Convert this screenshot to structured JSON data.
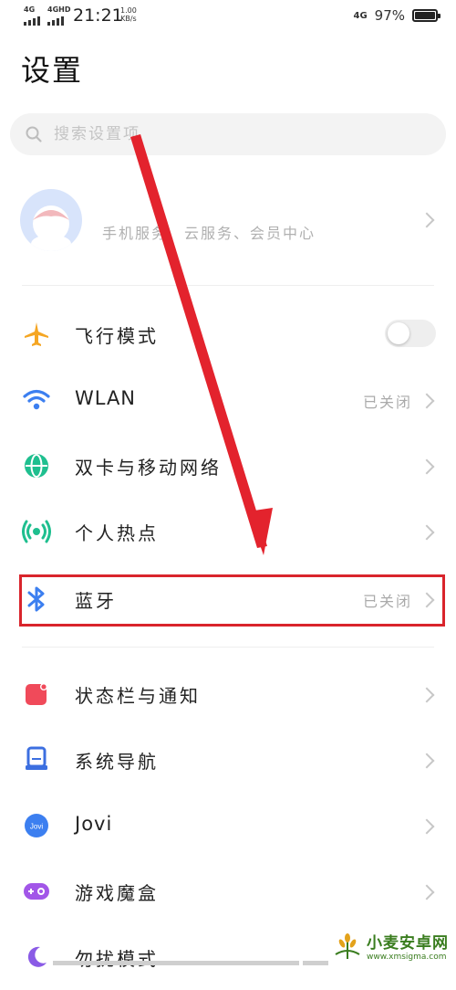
{
  "status_bar": {
    "sim1_label": "4G",
    "sim2_label": "4GHD",
    "time": "21:21",
    "speed_value": "1.00",
    "speed_unit": "KB/s",
    "network_label": "4G",
    "battery": "97%",
    "battery_level": 0.97
  },
  "title": "设置",
  "search": {
    "placeholder": "搜索设置项"
  },
  "account": {
    "text": "手机服务、云服务、会员中心"
  },
  "items": [
    {
      "label": "飞行模式",
      "icon": "airplane-icon",
      "color": "#f5a623",
      "toggle": false
    },
    {
      "label": "WLAN",
      "icon": "wifi-icon",
      "color": "#3c7ff0",
      "value": "已关闭"
    },
    {
      "label": "双卡与移动网络",
      "icon": "globe-icon",
      "color": "#1fbf8f"
    },
    {
      "label": "个人热点",
      "icon": "hotspot-icon",
      "color": "#1fbf8f"
    },
    {
      "label": "蓝牙",
      "icon": "bluetooth-icon",
      "color": "#3c7ff0",
      "value": "已关闭"
    },
    {
      "label": "状态栏与通知",
      "icon": "notification-icon",
      "color": "#f04a5a"
    },
    {
      "label": "系统导航",
      "icon": "navigation-icon",
      "color": "#3c6fe0"
    },
    {
      "label": "Jovi",
      "icon": "jovi-icon",
      "color": "#3c7ff0",
      "badge": "Jovi"
    },
    {
      "label": "游戏魔盒",
      "icon": "gamepad-icon",
      "color": "#a256e8"
    },
    {
      "label": "勿扰模式",
      "icon": "moon-icon",
      "color": "#8a5be6"
    }
  ],
  "annotation": {
    "highlight_color": "#d9242c"
  },
  "watermark": {
    "title": "小麦安卓网",
    "url": "www.xmsigma.com"
  }
}
